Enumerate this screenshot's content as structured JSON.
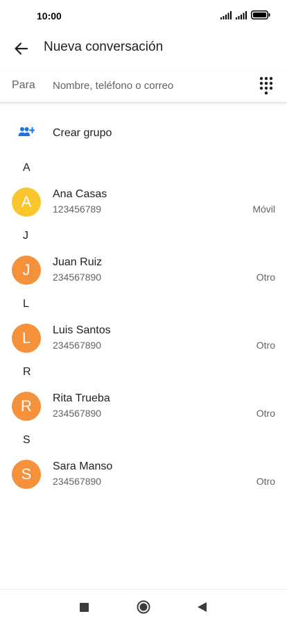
{
  "status_bar": {
    "time": "10:00"
  },
  "app_bar": {
    "title": "Nueva conversación"
  },
  "to_field": {
    "label": "Para",
    "placeholder": "Nombre, teléfono o correo",
    "value": ""
  },
  "create_group": {
    "label": "Crear grupo"
  },
  "sections": [
    {
      "letter": "A",
      "contacts": [
        {
          "initial": "A",
          "name": "Ana Casas",
          "phone": "123456789",
          "type": "Móvil",
          "avatar_color": "#f9c62d"
        }
      ]
    },
    {
      "letter": "J",
      "contacts": [
        {
          "initial": "J",
          "name": "Juan Ruiz",
          "phone": "234567890",
          "type": "Otro",
          "avatar_color": "#f4913a"
        }
      ]
    },
    {
      "letter": "L",
      "contacts": [
        {
          "initial": "L",
          "name": "Luis Santos",
          "phone": "234567890",
          "type": "Otro",
          "avatar_color": "#f4913a"
        }
      ]
    },
    {
      "letter": "R",
      "contacts": [
        {
          "initial": "R",
          "name": "Rita Trueba",
          "phone": "234567890",
          "type": "Otro",
          "avatar_color": "#f4913a"
        }
      ]
    },
    {
      "letter": "S",
      "contacts": [
        {
          "initial": "S",
          "name": "Sara Manso",
          "phone": "234567890",
          "type": "Otro",
          "avatar_color": "#f4913a"
        }
      ]
    }
  ],
  "icons": {
    "back": "arrow-back-icon",
    "dialpad": "dialpad-icon",
    "create_group": "group-add-icon",
    "nav_recents": "square-icon",
    "nav_home": "circle-icon",
    "nav_back": "triangle-back-icon"
  },
  "colors": {
    "accent": "#1a73e8"
  }
}
